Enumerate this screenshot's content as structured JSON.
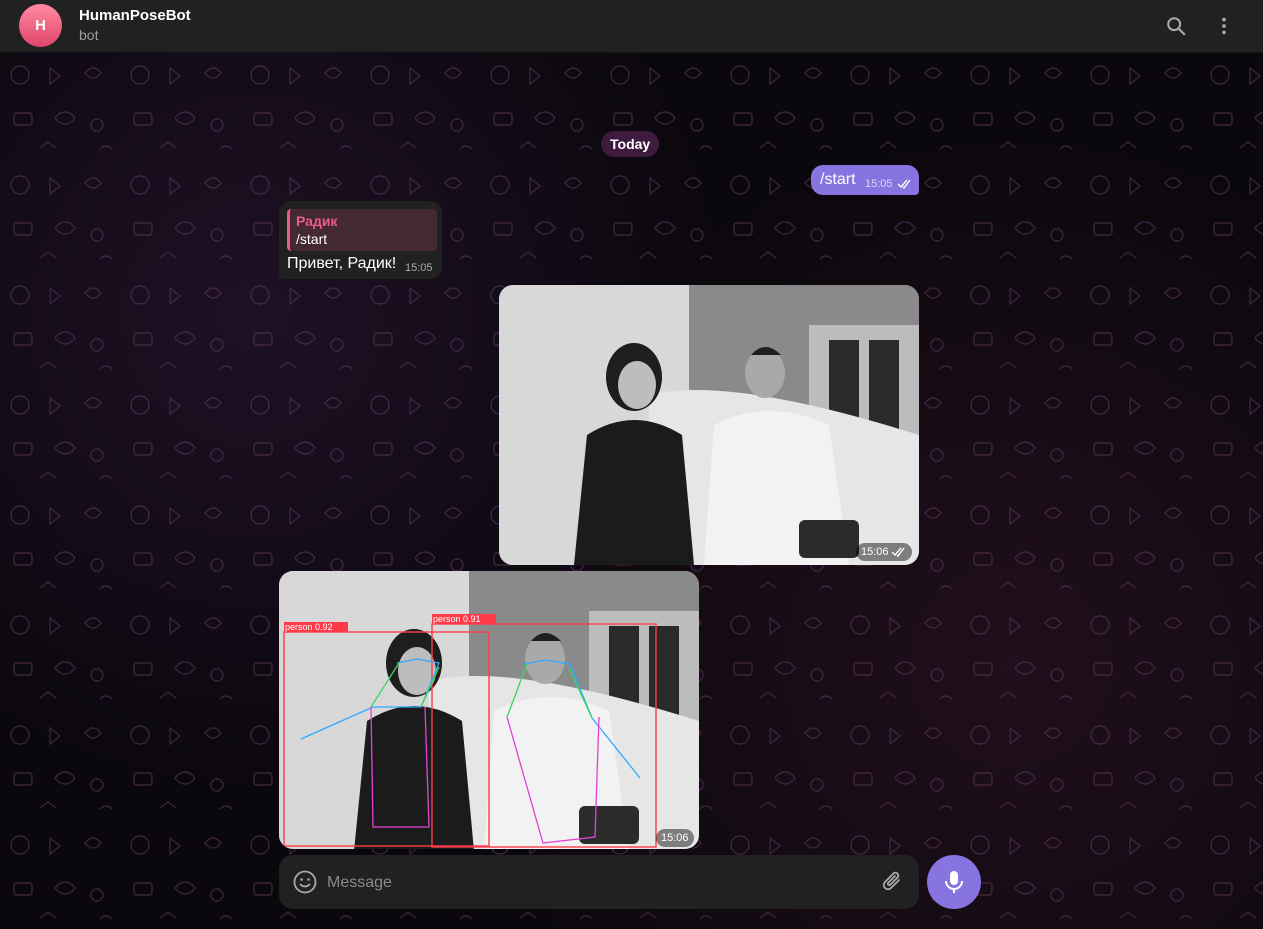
{
  "header": {
    "avatar_letter": "H",
    "title": "HumanPoseBot",
    "subtitle": "bot"
  },
  "chat": {
    "date_label": "Today",
    "outgoing_command": {
      "text": "/start",
      "time": "15:05"
    },
    "incoming_reply": {
      "reply_to_name": "Радик",
      "reply_to_text": "/start",
      "text": "Привет, Радик!",
      "time": "15:05"
    },
    "outgoing_photo": {
      "time": "15:06"
    },
    "incoming_photo": {
      "time": "15:06",
      "detections": [
        {
          "label": "person",
          "score": "0.92"
        },
        {
          "label": "person",
          "score": "0.91"
        }
      ]
    }
  },
  "composer": {
    "placeholder": "Message"
  },
  "colors": {
    "accent": "#8774e1",
    "reply_accent": "#ea5a8c",
    "detection_box": "#ff3b4a"
  },
  "icons": [
    "search-icon",
    "more-vertical-icon",
    "double-check-icon",
    "emoji-icon",
    "attach-icon",
    "mic-icon"
  ]
}
